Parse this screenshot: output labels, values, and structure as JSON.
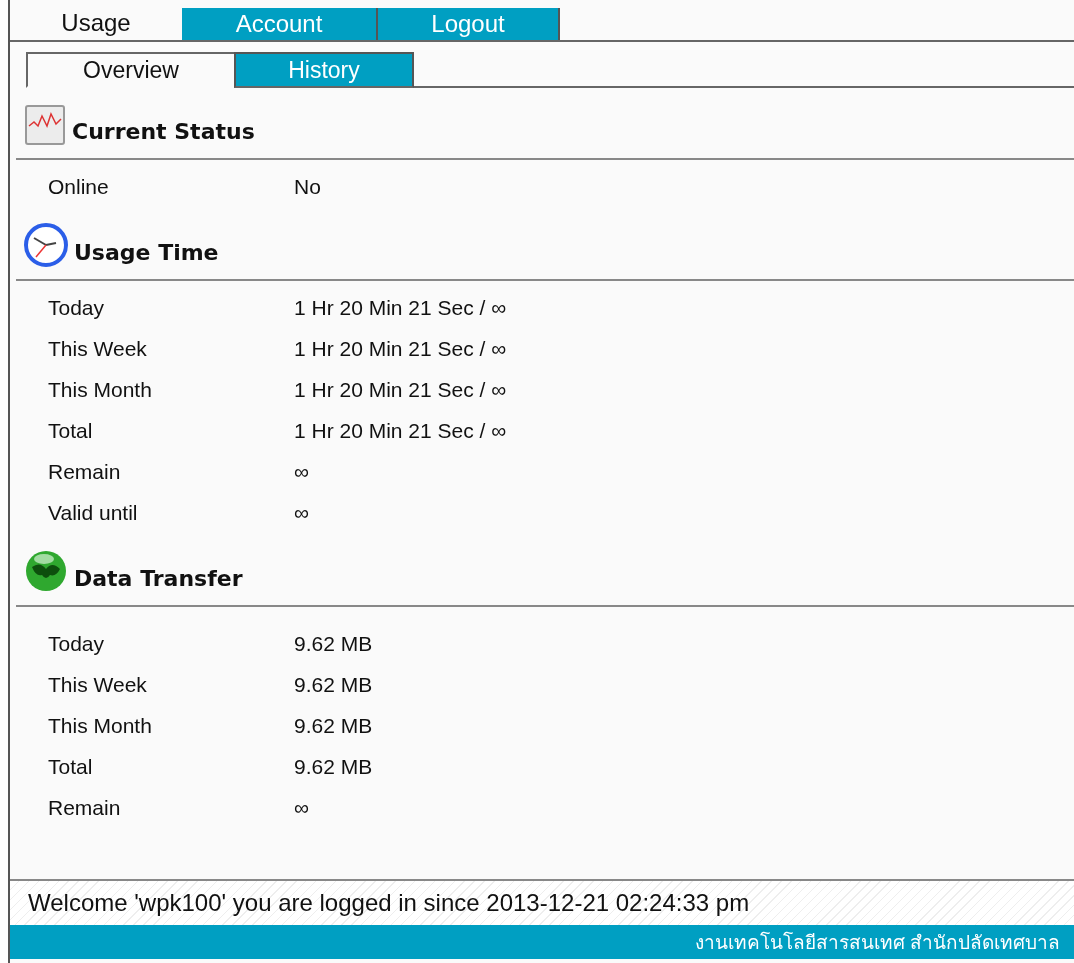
{
  "tabs": [
    {
      "label": "Usage",
      "selected": true
    },
    {
      "label": "Account",
      "selected": false
    },
    {
      "label": "Logout",
      "selected": false
    }
  ],
  "subtabs": [
    {
      "label": "Overview",
      "selected": true
    },
    {
      "label": "History",
      "selected": false
    }
  ],
  "sections": [
    {
      "kind": "chart",
      "title": "Current Status",
      "rows": [
        {
          "label": "Online",
          "value": "No"
        }
      ]
    },
    {
      "kind": "clock",
      "title": "Usage Time",
      "rows": [
        {
          "label": "Today",
          "value": "1 Hr 20 Min 21 Sec / ∞"
        },
        {
          "label": "This Week",
          "value": "1 Hr 20 Min 21 Sec / ∞"
        },
        {
          "label": "This Month",
          "value": "1 Hr 20 Min 21 Sec / ∞"
        },
        {
          "label": "Total",
          "value": "1 Hr 20 Min 21 Sec / ∞"
        },
        {
          "label": "Remain",
          "value": "∞"
        },
        {
          "label": "Valid until",
          "value": "∞"
        }
      ]
    },
    {
      "kind": "globe",
      "title": "Data Transfer",
      "rows": [
        {
          "label": "Today",
          "value": "9.62 MB"
        },
        {
          "label": "This Week",
          "value": "9.62 MB"
        },
        {
          "label": "This Month",
          "value": "9.62 MB"
        },
        {
          "label": "Total",
          "value": "9.62 MB"
        },
        {
          "label": "Remain",
          "value": "∞"
        }
      ]
    }
  ],
  "status": "Welcome 'wpk100' you are logged in since 2013-12-21 02:24:33 pm",
  "footer": "งานเทคโนโลยีสารสนเทศ สำนักปลัดเทศบาล"
}
